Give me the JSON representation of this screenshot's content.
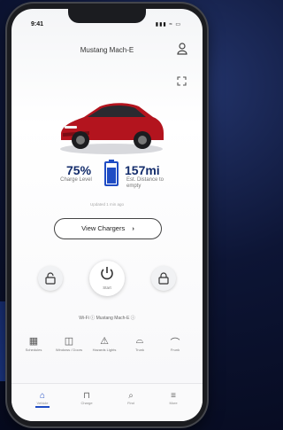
{
  "status": {
    "time": "9:41",
    "signal": "▮▮▮ ≈ ▭"
  },
  "header": {
    "title": "Mustang Mach-E",
    "profile_icon": "person-icon",
    "expand_icon": "expand-icon"
  },
  "vehicle": {
    "color": "#b3141e"
  },
  "battery": {
    "value": "75%",
    "label": "Charge Level",
    "level": 0.75,
    "color": "#1f4cc4"
  },
  "range": {
    "value": "157mi",
    "label": "Est. Distance to empty"
  },
  "updated": "Updated 1 min ago",
  "chargers": {
    "label": "View Chargers",
    "chevron": "›"
  },
  "controls": {
    "unlock_icon": "unlock-icon",
    "start": {
      "icon": "power-icon",
      "label": "Start"
    },
    "lock_icon": "lock-icon"
  },
  "wifi": {
    "text": "Wi-Fi ⓘ Mustang Mach-E ⓘ"
  },
  "quick_actions": [
    {
      "label": "Schedules",
      "icon": "calendar-icon"
    },
    {
      "label": "Windows / Doors",
      "icon": "car-door-icon"
    },
    {
      "label": "Hazards Lights",
      "icon": "hazard-icon"
    },
    {
      "label": "Trunk",
      "icon": "trunk-icon"
    },
    {
      "label": "Frunk",
      "icon": "frunk-icon"
    }
  ],
  "tabs": [
    {
      "label": "Vehicle",
      "icon": "home-icon",
      "active": true
    },
    {
      "label": "Charge",
      "icon": "garage-icon",
      "active": false
    },
    {
      "label": "Find",
      "icon": "search-icon",
      "active": false
    },
    {
      "label": "More",
      "icon": "more-icon",
      "active": false
    }
  ]
}
